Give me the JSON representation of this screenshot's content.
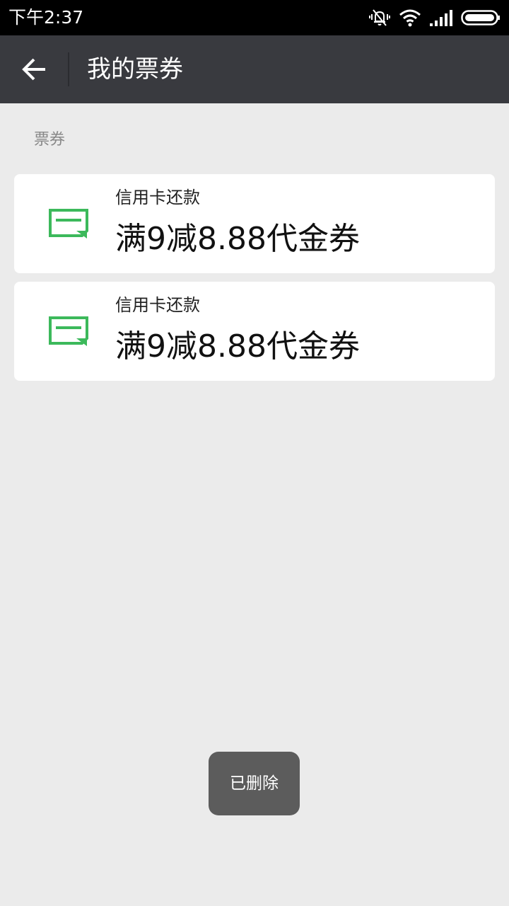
{
  "status_bar": {
    "time": "下午2:37",
    "icons": [
      "vibrate-mute-icon",
      "wifi-icon",
      "signal-icon",
      "battery-icon"
    ]
  },
  "app_bar": {
    "back_icon": "back-arrow-icon",
    "title": "我的票券"
  },
  "section": {
    "label": "票券"
  },
  "coupons": [
    {
      "category": "信用卡还款",
      "title": "满9减8.88代金券",
      "icon": "ticket-icon"
    },
    {
      "category": "信用卡还款",
      "title": "满9减8.88代金券",
      "icon": "ticket-icon"
    }
  ],
  "toast": {
    "text": "已删除"
  },
  "colors": {
    "status_bar_bg": "#000000",
    "app_bar_bg": "#393a3f",
    "page_bg": "#ebebeb",
    "card_bg": "#ffffff",
    "icon_green": "#3cb95b",
    "toast_bg": "#5c5c5c"
  }
}
